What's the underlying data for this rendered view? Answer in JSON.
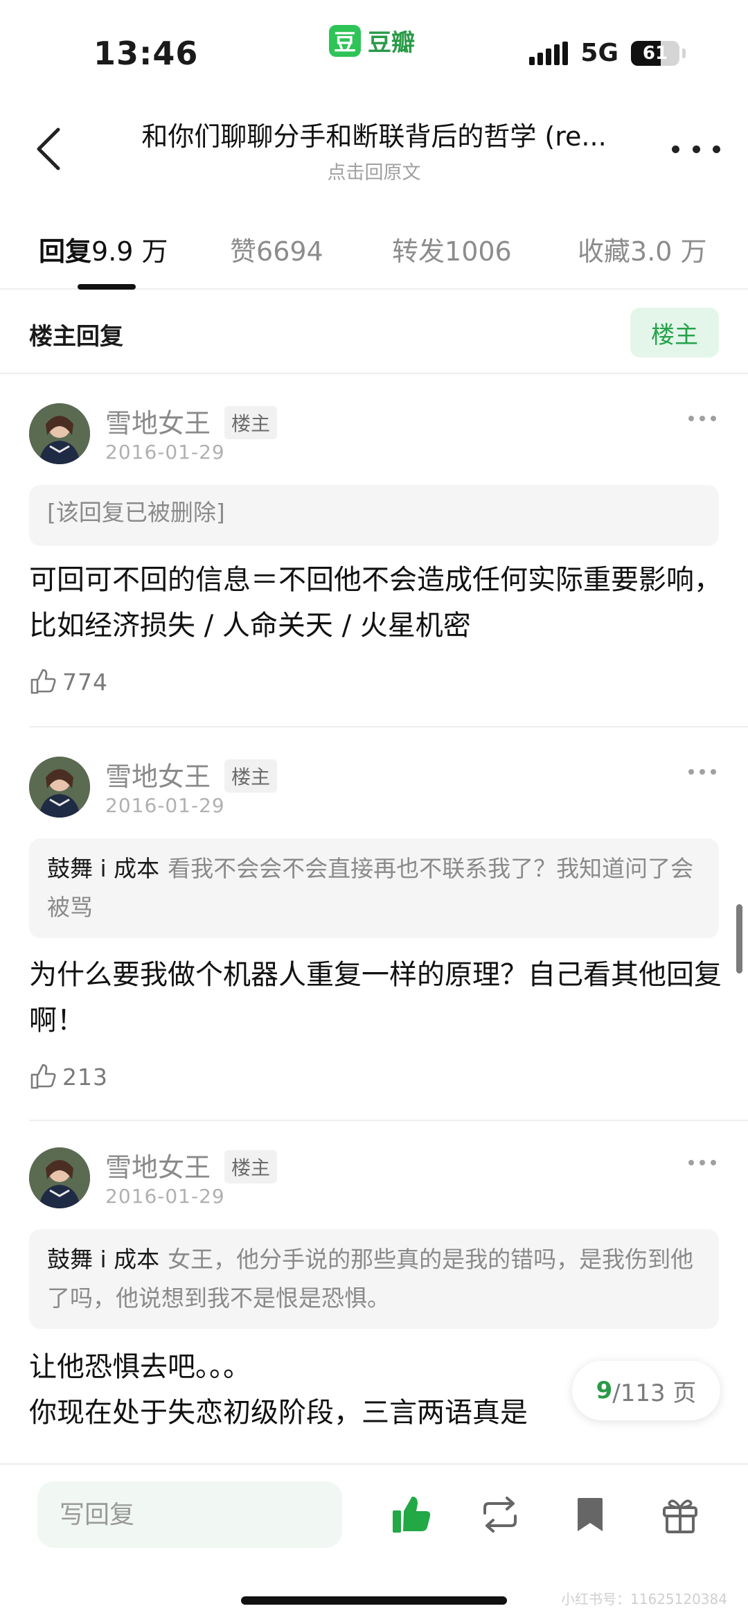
{
  "status_bar": {
    "time": "13:46",
    "app_logo_char": "豆",
    "app_name": "豆瓣",
    "network": "5G",
    "battery": "61",
    "battery_level": 0.61
  },
  "header": {
    "title": "和你们聊聊分手和断联背后的哲学 (re...",
    "subtitle": "点击回原文"
  },
  "tabs": [
    {
      "label": "回复",
      "count": "9.9 万"
    },
    {
      "label": "赞",
      "count": "6694"
    },
    {
      "label": "转发",
      "count": "1006"
    },
    {
      "label": "收藏",
      "count": "3.0 万"
    }
  ],
  "owner_section": {
    "title": "楼主回复",
    "filter_label": "楼主"
  },
  "comments": [
    {
      "user": "雪地女王",
      "tag": "楼主",
      "date": "2016-01-29",
      "quote_user": "",
      "quote_text": "[该回复已被删除]",
      "body": "可回可不回的信息＝不回他不会造成任何实际重要影响，比如经济损失 / 人命关天 / 火星机密",
      "likes": "774"
    },
    {
      "user": "雪地女王",
      "tag": "楼主",
      "date": "2016-01-29",
      "quote_user": "鼓舞 i 成本",
      "quote_text": "看我不会会不会直接再也不联系我了？我知道问了会被骂",
      "body": "为什么要我做个机器人重复一样的原理？自己看其他回复啊！",
      "likes": "213"
    },
    {
      "user": "雪地女王",
      "tag": "楼主",
      "date": "2016-01-29",
      "quote_user": "鼓舞 i 成本",
      "quote_text": "女王，他分手说的那些真的是我的错吗，是我伤到他了吗，他说想到我不是恨是恐惧。",
      "body_line1": "让他恐惧去吧。。。",
      "body_line2": "你现在处于失恋初级阶段，三言两语真是"
    }
  ],
  "pager": {
    "current": "9",
    "total": "/113 页"
  },
  "bottom_bar": {
    "reply_placeholder": "写回复",
    "icons": [
      "like-icon",
      "repost-icon",
      "bookmark-icon",
      "gift-icon"
    ]
  },
  "watermark": "小红书号：11625120384",
  "colors": {
    "accent_green": "#2a9a48",
    "like_active_green": "#22a845",
    "filter_bg": "#e4f6ea"
  }
}
